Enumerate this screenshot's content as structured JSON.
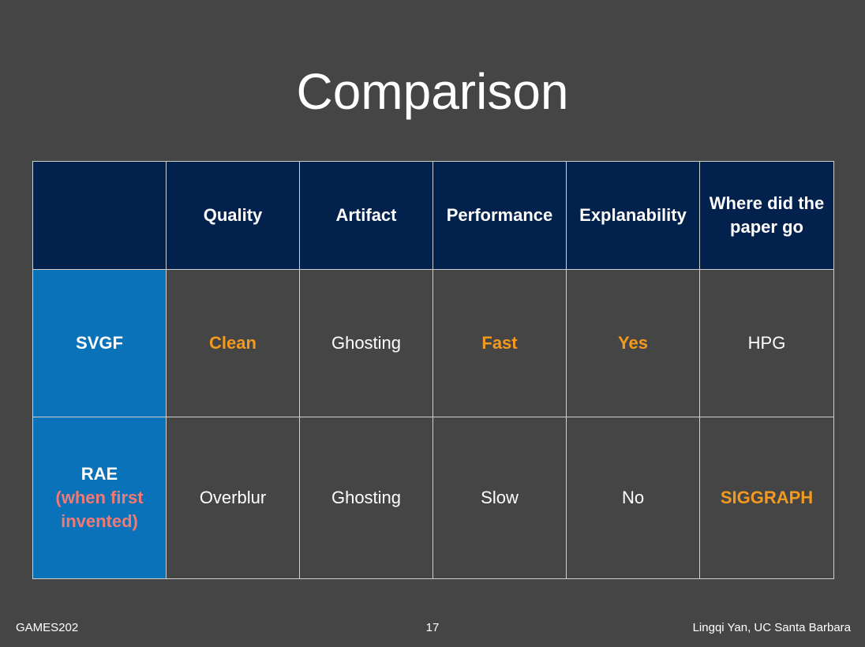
{
  "slide": {
    "title": "Comparison",
    "footer_left": "GAMES202",
    "page_number": "17",
    "footer_right": "Lingqi Yan, UC Santa Barbara"
  },
  "table": {
    "headers": [
      "",
      "Quality",
      "Artifact",
      "Performance",
      "Explanability",
      "Where did the paper go"
    ],
    "rows": [
      {
        "name": "SVGF",
        "note": "",
        "cells": [
          "Clean",
          "Ghosting",
          "Fast",
          "Yes",
          "HPG"
        ],
        "highlighted": [
          true,
          false,
          true,
          true,
          false
        ]
      },
      {
        "name": "RAE",
        "note": "(when first invented)",
        "cells": [
          "Overblur",
          "Ghosting",
          "Slow",
          "No",
          "SIGGRAPH"
        ],
        "highlighted": [
          false,
          false,
          false,
          false,
          true
        ]
      }
    ]
  },
  "colors": {
    "background": "#454545",
    "header_bg": "#03214d",
    "row_header_bg": "#0a72b8",
    "highlight": "#f39a1e",
    "note": "#f07a74"
  }
}
